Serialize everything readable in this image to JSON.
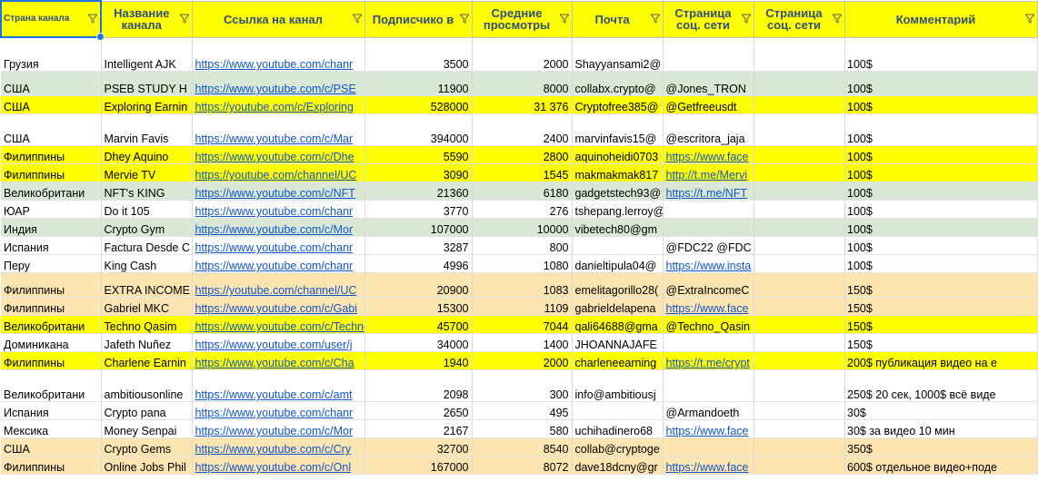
{
  "colors": {
    "header_bg": "#ffff00",
    "header_text": "#2f4f7f",
    "link": "#1155cc",
    "row_green": "#d9e8d4",
    "row_yellow": "#ffff00",
    "row_orange": "#fce5b0",
    "selection": "#1a73e8"
  },
  "headers": [
    "Страна канала",
    "Название канала",
    "Ссылка на канал",
    "Подписчико в",
    "Средние просмотры",
    "Почта",
    "Страница соц. сети",
    "Страница соц. сети",
    "",
    "Комментарий"
  ],
  "rows": [
    {
      "color": "white",
      "height": "tall",
      "cells": [
        "Грузия",
        "Intelligent AJK",
        "https://www.youtube.com/chanr",
        "3500",
        "2000",
        "Shayyansami2@",
        "",
        "",
        "",
        "100$"
      ]
    },
    {
      "color": "green",
      "height": "mid",
      "cells": [
        "США",
        "PSEB STUDY H",
        "https://www.youtube.com/c/PSE",
        "11900",
        "8000",
        "collabx.crypto@",
        "@Jones_TRON",
        "",
        "",
        "100$"
      ]
    },
    {
      "color": "yellow",
      "height": "normal",
      "cells": [
        "США",
        "Exploring Earnin",
        "https://youtube.com/c/Exploring",
        "528000",
        "31 376",
        "Cryptofree385@",
        "@Getfreeusdt",
        "",
        "",
        "100$"
      ]
    },
    {
      "color": "white",
      "height": "tall2",
      "cells": [
        "США",
        "Marvin Favis",
        "https://www.youtube.com/c/Mar",
        "394000",
        "2400",
        "marvinfavis15@",
        "@escritora_jaja",
        "",
        "",
        "100$"
      ]
    },
    {
      "color": "yellow",
      "height": "normal",
      "cells": [
        "Филиппины",
        "Dhey Aquino",
        "https://www.youtube.com/c/Dhe",
        "5590",
        "2800",
        "aquinoheidi0703",
        "https://www.face",
        "",
        "",
        "100$"
      ]
    },
    {
      "color": "yellow",
      "height": "normal",
      "cells": [
        "Филиппины",
        "Mervie TV",
        "https://youtube.com/channel/UC",
        "3090",
        "1545",
        "makmakmak817",
        "http://t.me/Mervi",
        "",
        "",
        "100$"
      ]
    },
    {
      "color": "green",
      "height": "normal",
      "cells": [
        "Великобритани",
        "NFT's KING",
        "https://www.youtube.com/c/NFT",
        "21360",
        "6180",
        "gadgetstech93@",
        "https://t.me/NFT",
        "",
        "",
        "100$"
      ]
    },
    {
      "color": "white",
      "height": "normal",
      "cells": [
        "ЮАР",
        "Do it 105",
        "https://www.youtube.com/chanr",
        "3770",
        "276",
        "tshepang.lerroy@",
        "",
        "",
        "",
        "100$"
      ]
    },
    {
      "color": "green",
      "height": "normal",
      "cells": [
        "Индия",
        "Crypto Gym",
        "https://www.youtube.com/c/Mor",
        "107000",
        "10000",
        "vibetech80@gm",
        "",
        "",
        "",
        "100$"
      ]
    },
    {
      "color": "white",
      "height": "normal",
      "cells": [
        "Испания",
        "Factura Desde C",
        "https://www.youtube.com/chanr",
        "3287",
        "800",
        "",
        "@FDC22 @FDC",
        "",
        "",
        "100$"
      ]
    },
    {
      "color": "white",
      "height": "normal",
      "cells": [
        "Перу",
        "King Cash",
        "https://www.youtube.com/chanr",
        "4996",
        "1080",
        "danieltipula04@",
        "https://www.insta",
        "",
        "",
        "100$"
      ]
    },
    {
      "color": "orange",
      "height": "mid",
      "cells": [
        "Филиппины",
        "EXTRA INCOME",
        "https://youtube.com/channel/UC",
        "20900",
        "1083",
        "emelitagorillo28(",
        "@ExtraIncomeC",
        "",
        "",
        "150$"
      ]
    },
    {
      "color": "orange",
      "height": "normal",
      "cells": [
        "Филиппины",
        "Gabriel MKC",
        "https://www.youtube.com/c/Gabi",
        "15300",
        "1109",
        "gabrieldelapena",
        "https://www.face",
        "",
        "",
        "150$"
      ]
    },
    {
      "color": "yellow",
      "height": "normal",
      "cells": [
        "Великобритани",
        "Techno Qasim",
        "https://www.youtube.com/c/TechnoQ",
        "45700",
        "7044",
        "qali64688@gma",
        "@Techno_Qasin",
        "",
        "",
        "150$"
      ]
    },
    {
      "color": "white",
      "height": "normal",
      "cells": [
        "Доминикана",
        "Jafeth Nuñez",
        "https://www.youtube.com/user/j",
        "34000",
        "1400",
        "JHOANNAJAFE",
        "",
        "",
        "",
        "150$"
      ]
    },
    {
      "color": "yellow",
      "height": "normal",
      "cells": [
        "Филиппины",
        "Charlene Earnin",
        "https://www.youtube.com/c/Cha",
        "1940",
        "2000",
        "charleneearning",
        "https://t.me/crypt",
        "",
        "",
        "200$ публикация видео на е"
      ]
    },
    {
      "color": "white",
      "height": "tall2",
      "cells": [
        "Великобритани",
        "ambitiousonline",
        "https://www.youtube.com/c/amt",
        "2098",
        "300",
        "info@ambitiousj",
        "",
        "",
        "",
        "250$ 20 сек, 1000$ всё виде"
      ]
    },
    {
      "color": "white",
      "height": "normal",
      "cells": [
        "Испания",
        "Crypto pana",
        "https://www.youtube.com/chanr",
        "2650",
        "495",
        "",
        "@Armandoeth",
        "",
        "",
        "30$"
      ]
    },
    {
      "color": "white",
      "height": "normal",
      "cells": [
        "Мексика",
        "Money Senpai",
        "https://www.youtube.com/c/Mor",
        "2167",
        "580",
        "uchihadinero68",
        "https://www.face",
        "",
        "",
        "30$ за видео 10 мин"
      ]
    },
    {
      "color": "orange",
      "height": "normal",
      "cells": [
        "США",
        "Crypto Gems",
        "https://www.youtube.com/c/Cry",
        "32700",
        "8540",
        "collab@cryptoge",
        "",
        "",
        "",
        "350$"
      ]
    },
    {
      "color": "orange",
      "height": "normal",
      "cells": [
        "Филиппины",
        "Online Jobs Phil",
        "https://www.youtube.com/c/Onl",
        "167000",
        "8072",
        "dave18dcny@gr",
        "https://www.face",
        "",
        "",
        "600$ отдельное видео+поде"
      ]
    }
  ]
}
